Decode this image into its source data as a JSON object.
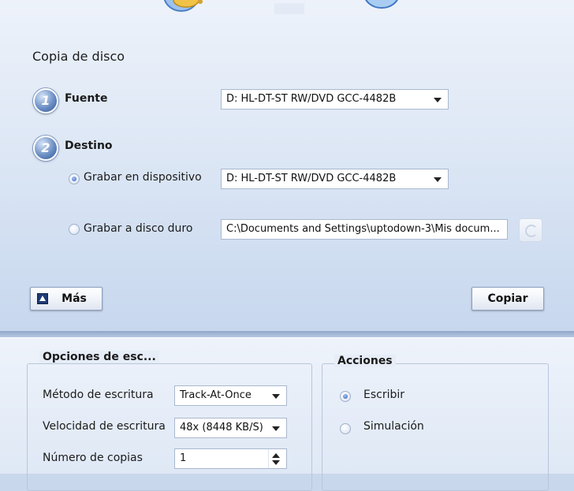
{
  "copy": {
    "title": "Copia de disco",
    "source": {
      "step": "1",
      "label": "Fuente",
      "device": "D: HL-DT-ST RW/DVD GCC-4482B"
    },
    "destination": {
      "step": "2",
      "label": "Destino",
      "burn_device_label": "Grabar en dispositivo",
      "burn_device_value": "D: HL-DT-ST RW/DVD GCC-4482B",
      "burn_hdd_label": "Grabar a disco duro",
      "burn_hdd_path": "C:\\Documents and Settings\\uptodown-3\\Mis docum...",
      "selected": "device"
    },
    "more_button": "Más",
    "copy_button": "Copiar"
  },
  "options": {
    "title": "Opciones de esc...",
    "write_method_label": "Método de escritura",
    "write_method_value": "Track-At-Once",
    "write_speed_label": "Velocidad de escritura",
    "write_speed_value": "48x (8448 KB/S)",
    "copies_label": "Número de copias",
    "copies_value": "1"
  },
  "actions": {
    "title": "Acciones",
    "write_label": "Escribir",
    "simulate_label": "Simulación",
    "selected": "write"
  },
  "icons": {
    "header": [
      "disc-audio-icon",
      "disc-copy-icon",
      "disc-erase-icon"
    ],
    "more": "arrow-up-icon",
    "browse": "refresh-icon"
  }
}
